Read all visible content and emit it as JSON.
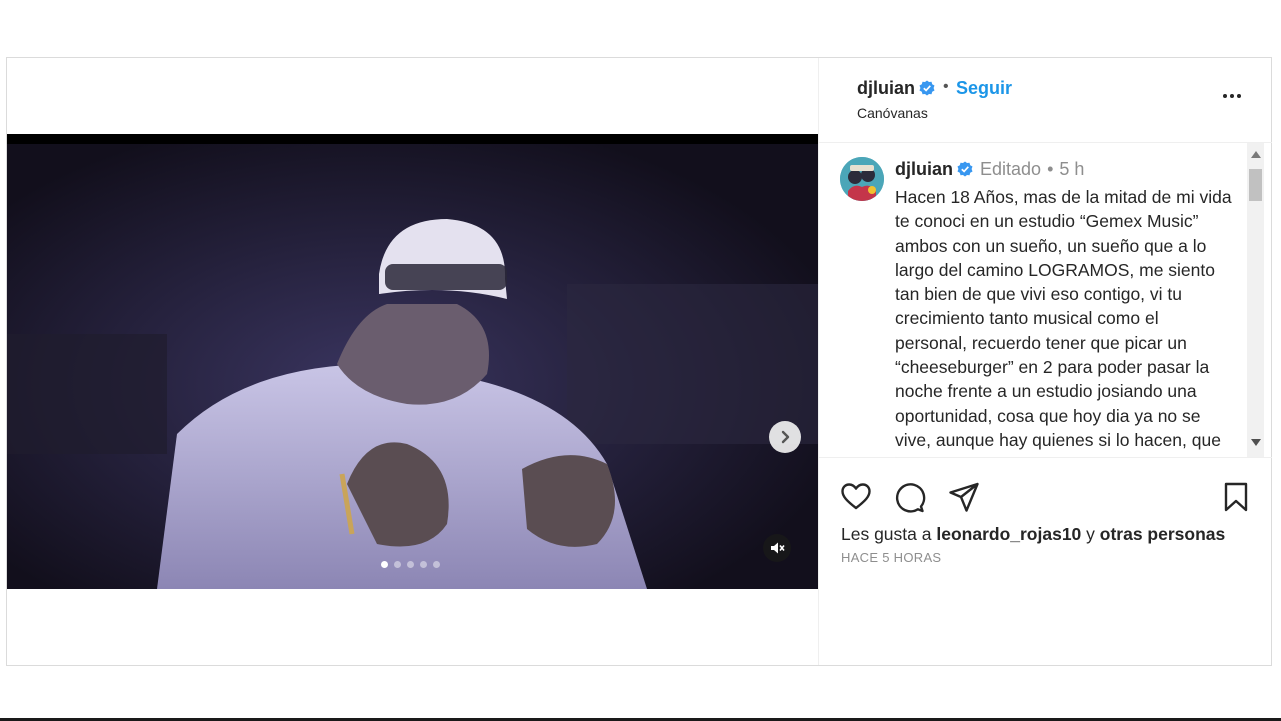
{
  "post": {
    "username": "djluian",
    "separator": "•",
    "follow_label": "Seguir",
    "location": "Canóvanas",
    "carousel": {
      "slides": 5,
      "active_index": 0
    }
  },
  "caption": {
    "username": "djluian",
    "edited_label": "Editado",
    "separator": "•",
    "time": "5 h",
    "text": "Hacen 18 Años, mas de la mitad de mi vida te conoci en un estudio “Gemex Music” ambos con un sueño, un sueño que a lo largo del camino LOGRAMOS, me siento tan bien de que vivi eso contigo, vi tu crecimiento tanto musical como el personal, recuerdo tener que picar un “cheeseburger” en 2 para poder pasar la noche frente a un estudio josiando una oportunidad, cosa que hoy dia ya no se vive, aunque hay quienes si lo hacen, que dios te bendiga siempre."
  },
  "likes": {
    "prefix": "Les gusta a",
    "user": "leonardo_rojas10",
    "connector": "y",
    "others": "otras personas"
  },
  "timestamp": "HACE 5 HORAS",
  "icons": {
    "verified": "verified-badge-icon",
    "more": "more-options-icon",
    "next": "chevron-right-icon",
    "mute": "muted-speaker-icon",
    "like": "heart-icon",
    "comment": "comment-bubble-icon",
    "share": "paper-plane-icon",
    "save": "bookmark-icon"
  },
  "colors": {
    "accent": "#1c96e8",
    "verified": "#3897f0",
    "text": "#262626",
    "muted": "#8e8e8e"
  }
}
